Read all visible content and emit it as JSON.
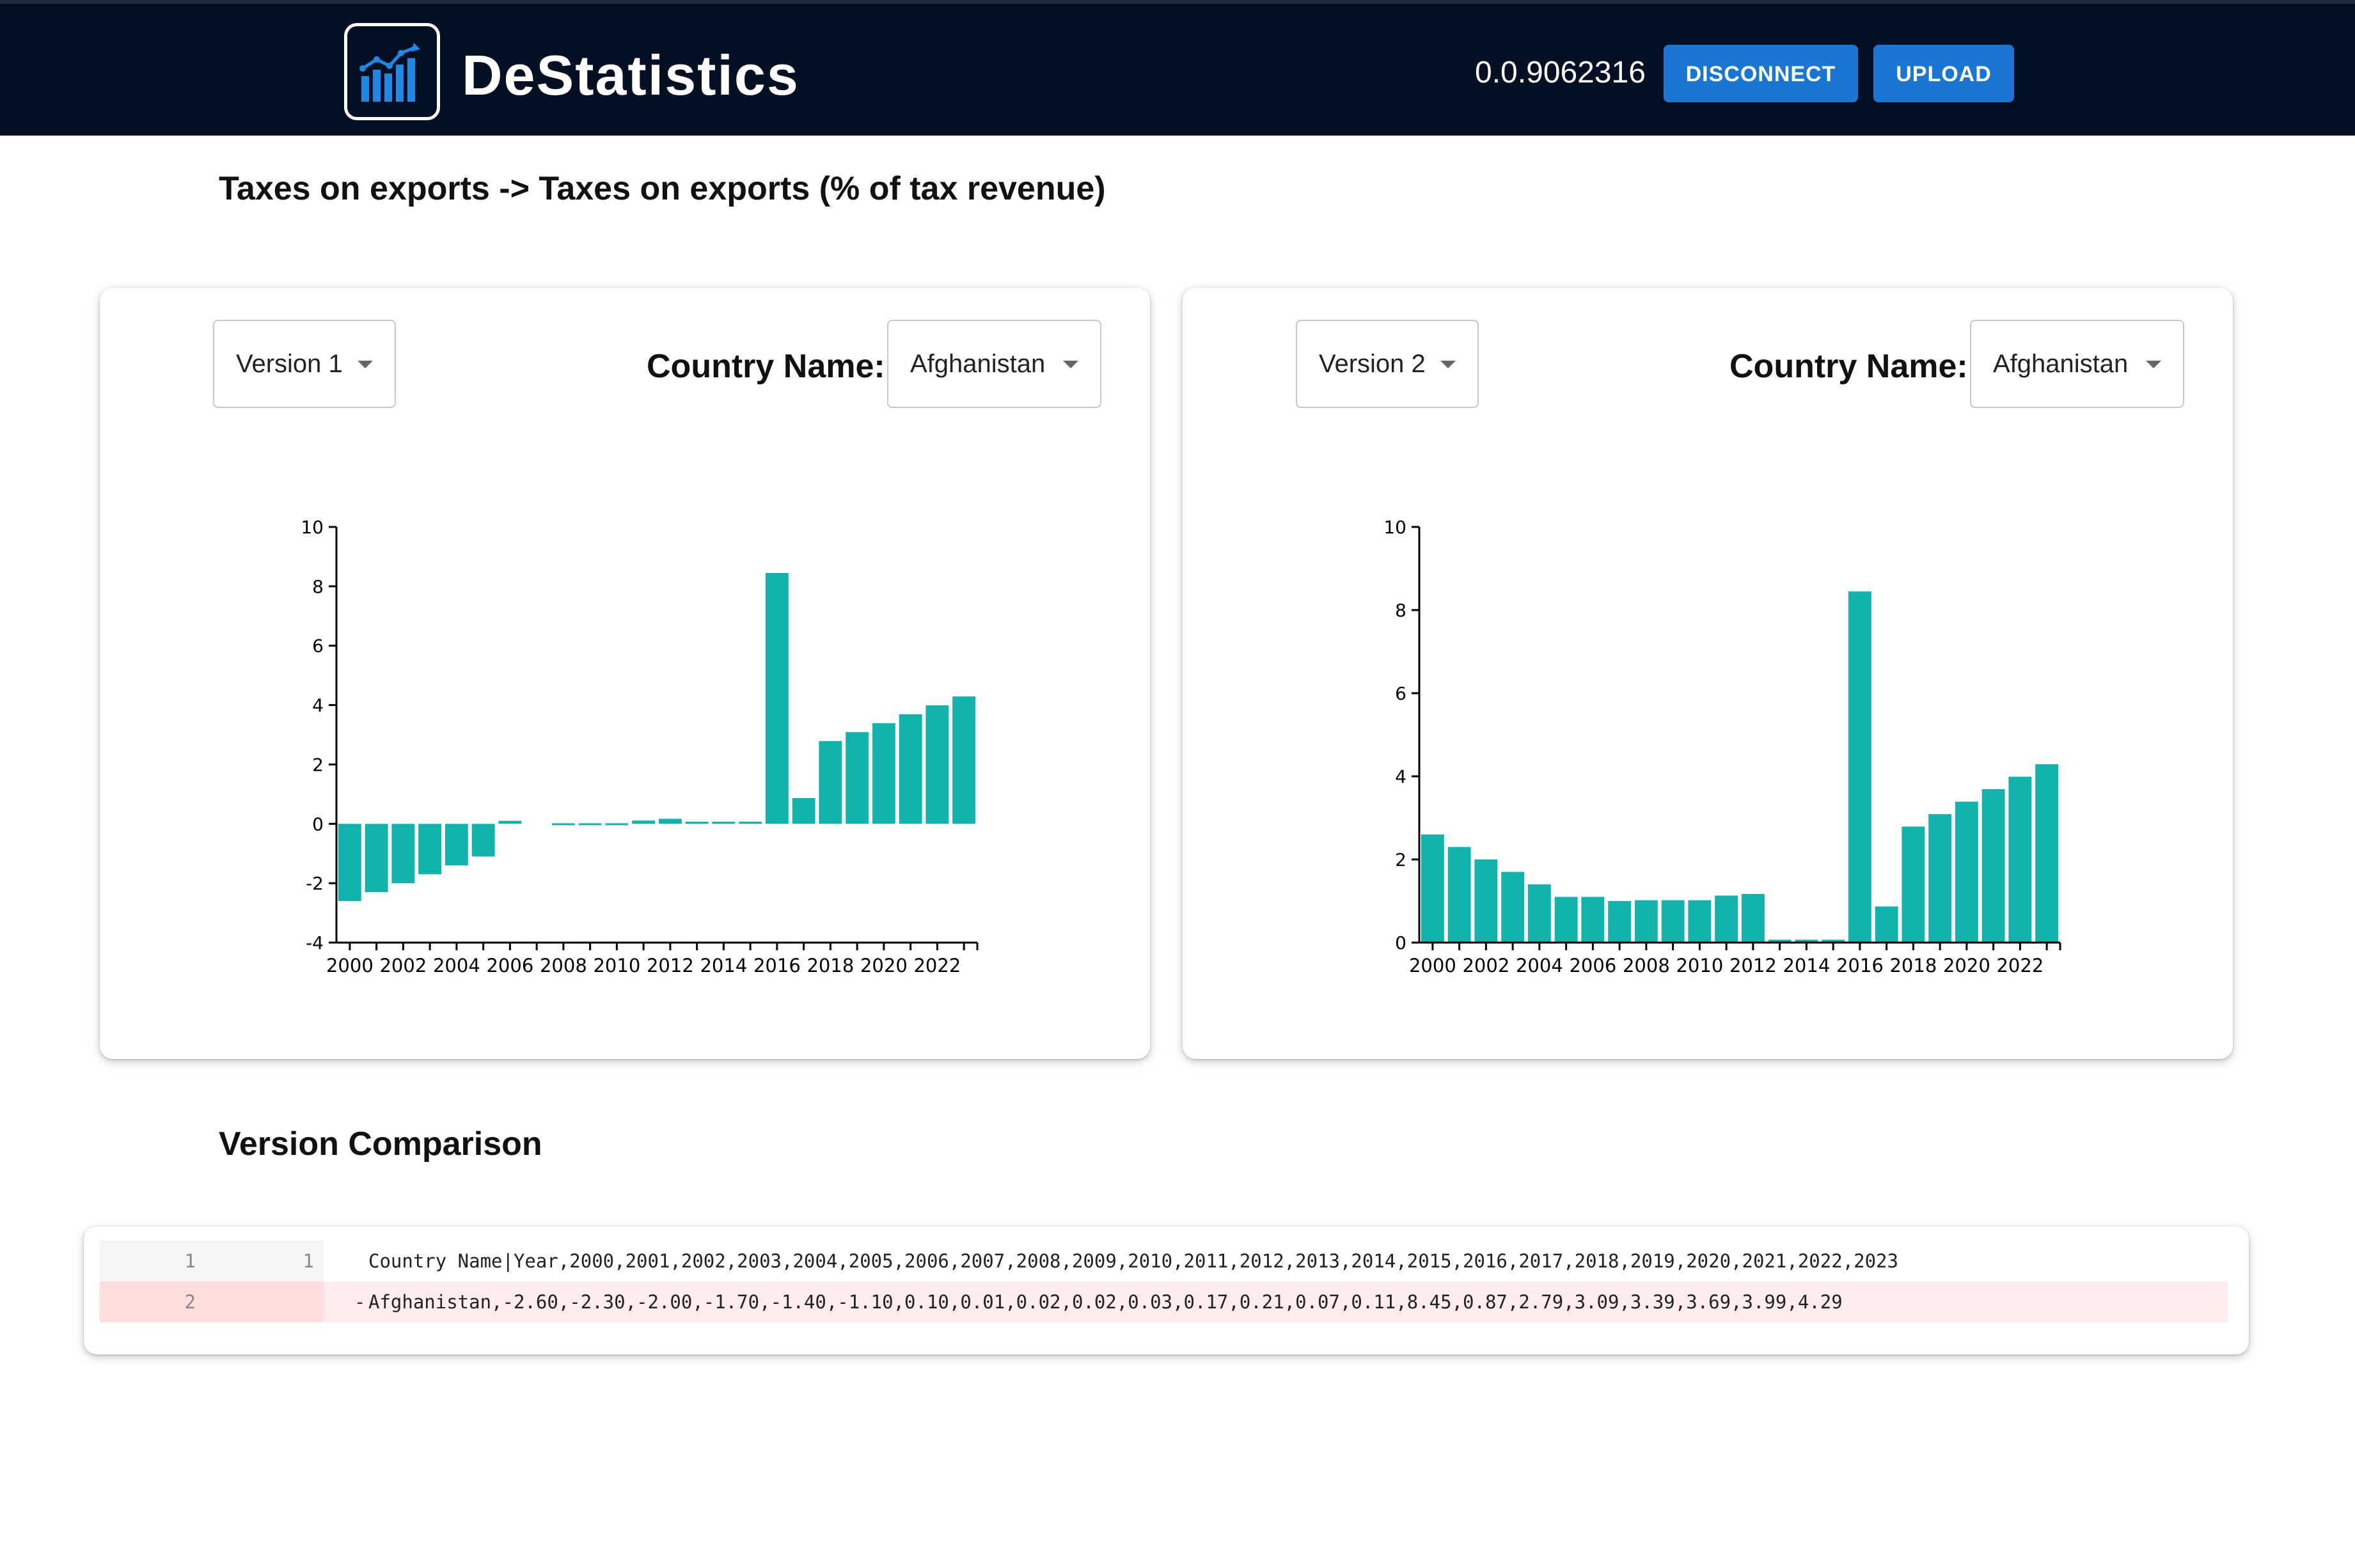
{
  "header": {
    "app_name": "DeStatistics",
    "account_id": "0.0.9062316",
    "disconnect_label": "DISCONNECT",
    "upload_label": "UPLOAD",
    "background_color": "#030f22",
    "button_color": "#1976d2"
  },
  "page_title": "Taxes on exports -> Taxes on exports (% of tax revenue)",
  "panels": [
    {
      "version_selected": "Version 1",
      "country_label": "Country Name:",
      "country_selected": "Afghanistan"
    },
    {
      "version_selected": "Version 2",
      "country_label": "Country Name:",
      "country_selected": "Afghanistan"
    }
  ],
  "chart_data": [
    {
      "type": "bar",
      "color": "#12b3ad",
      "categories": [
        "2000",
        "2001",
        "2002",
        "2003",
        "2004",
        "2005",
        "2006",
        "2007",
        "2008",
        "2009",
        "2010",
        "2011",
        "2012",
        "2013",
        "2014",
        "2015",
        "2016",
        "2017",
        "2018",
        "2019",
        "2020",
        "2021",
        "2022",
        "2023"
      ],
      "values": [
        -2.6,
        -2.3,
        -2.0,
        -1.7,
        -1.4,
        -1.1,
        0.1,
        0,
        0.02,
        0.02,
        0.02,
        0.11,
        0.17,
        0.07,
        0.07,
        0.07,
        8.45,
        0.87,
        2.79,
        3.09,
        3.39,
        3.69,
        3.99,
        4.29
      ],
      "x_tick_labels": [
        "2000",
        "2002",
        "2004",
        "2006",
        "2008",
        "2010",
        "2012",
        "2014",
        "2016",
        "2018",
        "2020",
        "2022"
      ],
      "y_ticks": [
        -4,
        -2,
        0,
        2,
        4,
        6,
        8,
        10
      ],
      "ylim": [
        -4,
        10
      ]
    },
    {
      "type": "bar",
      "color": "#12b3ad",
      "categories": [
        "2000",
        "2001",
        "2002",
        "2003",
        "2004",
        "2005",
        "2006",
        "2007",
        "2008",
        "2009",
        "2010",
        "2011",
        "2012",
        "2013",
        "2014",
        "2015",
        "2016",
        "2017",
        "2018",
        "2019",
        "2020",
        "2021",
        "2022",
        "2023"
      ],
      "values": [
        2.6,
        2.3,
        2.0,
        1.7,
        1.4,
        1.1,
        1.1,
        1.0,
        1.02,
        1.02,
        1.02,
        1.13,
        1.17,
        0.07,
        0.07,
        0.07,
        8.45,
        0.87,
        2.79,
        3.09,
        3.39,
        3.69,
        3.99,
        4.29
      ],
      "x_tick_labels": [
        "2000",
        "2002",
        "2004",
        "2006",
        "2008",
        "2010",
        "2012",
        "2014",
        "2016",
        "2018",
        "2020",
        "2022"
      ],
      "y_ticks": [
        0,
        2,
        4,
        6,
        8,
        10
      ],
      "ylim": [
        0,
        10
      ]
    }
  ],
  "comparison": {
    "title": "Version Comparison",
    "rows": [
      {
        "old_line": "1",
        "new_line": "1",
        "marker": "",
        "text": "Country Name|Year,2000,2001,2002,2003,2004,2005,2006,2007,2008,2009,2010,2011,2012,2013,2014,2015,2016,2017,2018,2019,2020,2021,2022,2023"
      },
      {
        "old_line": "2",
        "new_line": "",
        "marker": "-",
        "text": "Afghanistan,-2.60,-2.30,-2.00,-1.70,-1.40,-1.10,0.10,0.01,0.02,0.02,0.03,0.17,0.21,0.07,0.11,8.45,0.87,2.79,3.09,3.39,3.69,3.99,4.29"
      }
    ]
  }
}
